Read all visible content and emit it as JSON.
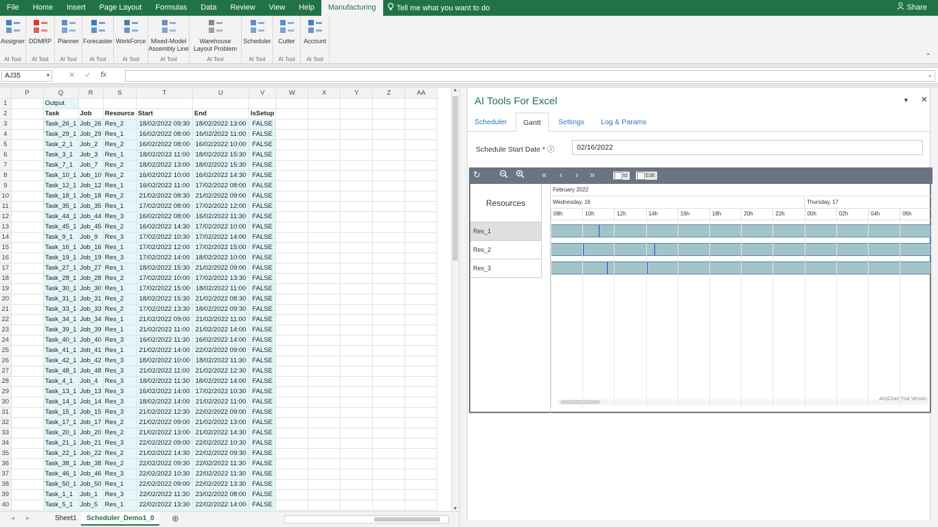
{
  "ribbon_tabs": [
    "File",
    "Home",
    "Insert",
    "Page Layout",
    "Formulas",
    "Data",
    "Review",
    "View",
    "Help",
    "Manufacturing"
  ],
  "tell_me": "Tell me what you want to do",
  "share": "Share",
  "ribbon_buttons": [
    {
      "label": "Assigner",
      "group": "AI Tool",
      "icon": "assigner-icon"
    },
    {
      "label": "DDMRP",
      "group": "AI Tool",
      "icon": "ddmrp-icon"
    },
    {
      "label": "Planner",
      "group": "AI Tool",
      "icon": "planner-icon"
    },
    {
      "label": "Forecaster",
      "group": "AI Tool",
      "icon": "forecaster-icon"
    },
    {
      "label": "WorkForce",
      "group": "AI Tool",
      "icon": "workforce-icon"
    },
    {
      "label": "Mixed-Model\nAssembly Line",
      "group": "AI Tool",
      "icon": "assembly-line-icon"
    },
    {
      "label": "Warehouse\nLayout Problem",
      "group": "AI Tool",
      "icon": "warehouse-icon"
    },
    {
      "label": "Scheduler",
      "group": "AI Tool",
      "icon": "scheduler-icon"
    },
    {
      "label": "Cutter",
      "group": "AI Tool",
      "icon": "cutter-icon"
    },
    {
      "label": "Account",
      "group": "AI Tool",
      "icon": "account-icon"
    }
  ],
  "formula_bar": {
    "name_box": "AJ35",
    "formula": ""
  },
  "grid": {
    "columns": [
      "P",
      "Q",
      "R",
      "S",
      "T",
      "U",
      "V",
      "W",
      "X",
      "Y",
      "Z",
      "AA"
    ],
    "output_label": "Output",
    "headers": [
      "Task",
      "Job",
      "Resource",
      "Start",
      "End",
      "IsSetup"
    ],
    "rows": [
      [
        "Task_26_1",
        "Job_26",
        "Res_2",
        "18/02/2022 09:30",
        "18/02/2022 13:00",
        "FALSE"
      ],
      [
        "Task_29_1",
        "Job_29",
        "Res_1",
        "16/02/2022 08:00",
        "16/02/2022 11:00",
        "FALSE"
      ],
      [
        "Task_2_1",
        "Job_2",
        "Res_2",
        "16/02/2022 08:00",
        "16/02/2022 10:00",
        "FALSE"
      ],
      [
        "Task_3_1",
        "Job_3",
        "Res_1",
        "18/02/2022 11:00",
        "18/02/2022 15:30",
        "FALSE"
      ],
      [
        "Task_7_1",
        "Job_7",
        "Res_2",
        "18/02/2022 13:00",
        "18/02/2022 15:30",
        "FALSE"
      ],
      [
        "Task_10_1",
        "Job_10",
        "Res_2",
        "16/02/2022 10:00",
        "16/02/2022 14:30",
        "FALSE"
      ],
      [
        "Task_12_1",
        "Job_12",
        "Res_1",
        "16/02/2022 11:00",
        "17/02/2022 08:00",
        "FALSE"
      ],
      [
        "Task_18_1",
        "Job_18",
        "Res_2",
        "21/02/2022 08:30",
        "21/02/2022 09:00",
        "FALSE"
      ],
      [
        "Task_35_1",
        "Job_35",
        "Res_1",
        "17/02/2022 08:00",
        "17/02/2022 12:00",
        "FALSE"
      ],
      [
        "Task_44_1",
        "Job_44",
        "Res_3",
        "16/02/2022 08:00",
        "16/02/2022 11:30",
        "FALSE"
      ],
      [
        "Task_45_1",
        "Job_45",
        "Res_2",
        "16/02/2022 14:30",
        "17/02/2022 10:00",
        "FALSE"
      ],
      [
        "Task_9_1",
        "Job_9",
        "Res_3",
        "17/02/2022 10:30",
        "17/02/2022 14:00",
        "FALSE"
      ],
      [
        "Task_16_1",
        "Job_16",
        "Res_1",
        "17/02/2022 12:00",
        "17/02/2022 15:00",
        "FALSE"
      ],
      [
        "Task_19_1",
        "Job_19",
        "Res_3",
        "17/02/2022 14:00",
        "18/02/2022 10:00",
        "FALSE"
      ],
      [
        "Task_27_1",
        "Job_27",
        "Res_1",
        "18/02/2022 15:30",
        "21/02/2022 09:00",
        "FALSE"
      ],
      [
        "Task_28_1",
        "Job_28",
        "Res_2",
        "17/02/2022 10:00",
        "17/02/2022 13:30",
        "FALSE"
      ],
      [
        "Task_30_1",
        "Job_30",
        "Res_1",
        "17/02/2022 15:00",
        "18/02/2022 11:00",
        "FALSE"
      ],
      [
        "Task_31_1",
        "Job_31",
        "Res_2",
        "18/02/2022 15:30",
        "21/02/2022 08:30",
        "FALSE"
      ],
      [
        "Task_33_1",
        "Job_33",
        "Res_2",
        "17/02/2022 13:30",
        "18/02/2022 09:30",
        "FALSE"
      ],
      [
        "Task_34_1",
        "Job_34",
        "Res_1",
        "21/02/2022 09:00",
        "21/02/2022 11:00",
        "FALSE"
      ],
      [
        "Task_39_1",
        "Job_39",
        "Res_1",
        "21/02/2022 11:00",
        "21/02/2022 14:00",
        "FALSE"
      ],
      [
        "Task_40_1",
        "Job_40",
        "Res_3",
        "16/02/2022 11:30",
        "16/02/2022 14:00",
        "FALSE"
      ],
      [
        "Task_41_1",
        "Job_41",
        "Res_1",
        "21/02/2022 14:00",
        "22/02/2022 09:00",
        "FALSE"
      ],
      [
        "Task_42_1",
        "Job_42",
        "Res_3",
        "18/02/2022 10:00",
        "18/02/2022 11:30",
        "FALSE"
      ],
      [
        "Task_48_1",
        "Job_48",
        "Res_3",
        "21/02/2022 11:00",
        "21/02/2022 12:30",
        "FALSE"
      ],
      [
        "Task_4_1",
        "Job_4",
        "Res_3",
        "18/02/2022 11:30",
        "18/02/2022 14:00",
        "FALSE"
      ],
      [
        "Task_13_1",
        "Job_13",
        "Res_3",
        "16/02/2022 14:00",
        "17/02/2022 10:30",
        "FALSE"
      ],
      [
        "Task_14_1",
        "Job_14",
        "Res_3",
        "18/02/2022 14:00",
        "21/02/2022 11:00",
        "FALSE"
      ],
      [
        "Task_15_1",
        "Job_15",
        "Res_3",
        "21/02/2022 12:30",
        "22/02/2022 09:00",
        "FALSE"
      ],
      [
        "Task_17_1",
        "Job_17",
        "Res_2",
        "21/02/2022 09:00",
        "21/02/2022 13:00",
        "FALSE"
      ],
      [
        "Task_20_1",
        "Job_20",
        "Res_2",
        "21/02/2022 13:00",
        "21/02/2022 14:30",
        "FALSE"
      ],
      [
        "Task_21_1",
        "Job_21",
        "Res_3",
        "22/02/2022 09:00",
        "22/02/2022 10:30",
        "FALSE"
      ],
      [
        "Task_22_1",
        "Job_22",
        "Res_2",
        "21/02/2022 14:30",
        "22/02/2022 09:30",
        "FALSE"
      ],
      [
        "Task_38_1",
        "Job_38",
        "Res_2",
        "22/02/2022 09:30",
        "22/02/2022 11:30",
        "FALSE"
      ],
      [
        "Task_46_1",
        "Job_46",
        "Res_3",
        "22/02/2022 10:30",
        "22/02/2022 11:30",
        "FALSE"
      ],
      [
        "Task_50_1",
        "Job_50",
        "Res_1",
        "22/02/2022 09:00",
        "22/02/2022 13:30",
        "FALSE"
      ],
      [
        "Task_1_1",
        "Job_1",
        "Res_3",
        "22/02/2022 11:30",
        "23/02/2022 08:00",
        "FALSE"
      ],
      [
        "Task_5_1",
        "Job_5",
        "Res_1",
        "22/02/2022 13:30",
        "22/02/2022 14:00",
        "FALSE"
      ]
    ]
  },
  "sheet_tabs": [
    "Sheet1",
    "Scheduler_Demo1_0"
  ],
  "pane": {
    "title": "AI Tools For Excel",
    "tabs": [
      "Scheduler",
      "Gantt",
      "Settings",
      "Log & Params"
    ],
    "active_tab": "Gantt",
    "schedule_start_label": "Schedule Start Date * ⓘ",
    "schedule_start_value": "02/16/2022"
  },
  "gantt": {
    "checkboxes": [
      "Id",
      "Edit"
    ],
    "resources_label": "Resources",
    "month": "February 2022",
    "days": [
      "Wednesday, 16",
      "Thursday, 17"
    ],
    "hours": [
      "08h",
      "10h",
      "12h",
      "14h",
      "16h",
      "18h",
      "20h",
      "22h",
      "00h",
      "02h",
      "04h",
      "06h"
    ],
    "resources": [
      "Res_1",
      "Res_2",
      "Res_3"
    ],
    "credit": "AnyChart Trial Version"
  }
}
